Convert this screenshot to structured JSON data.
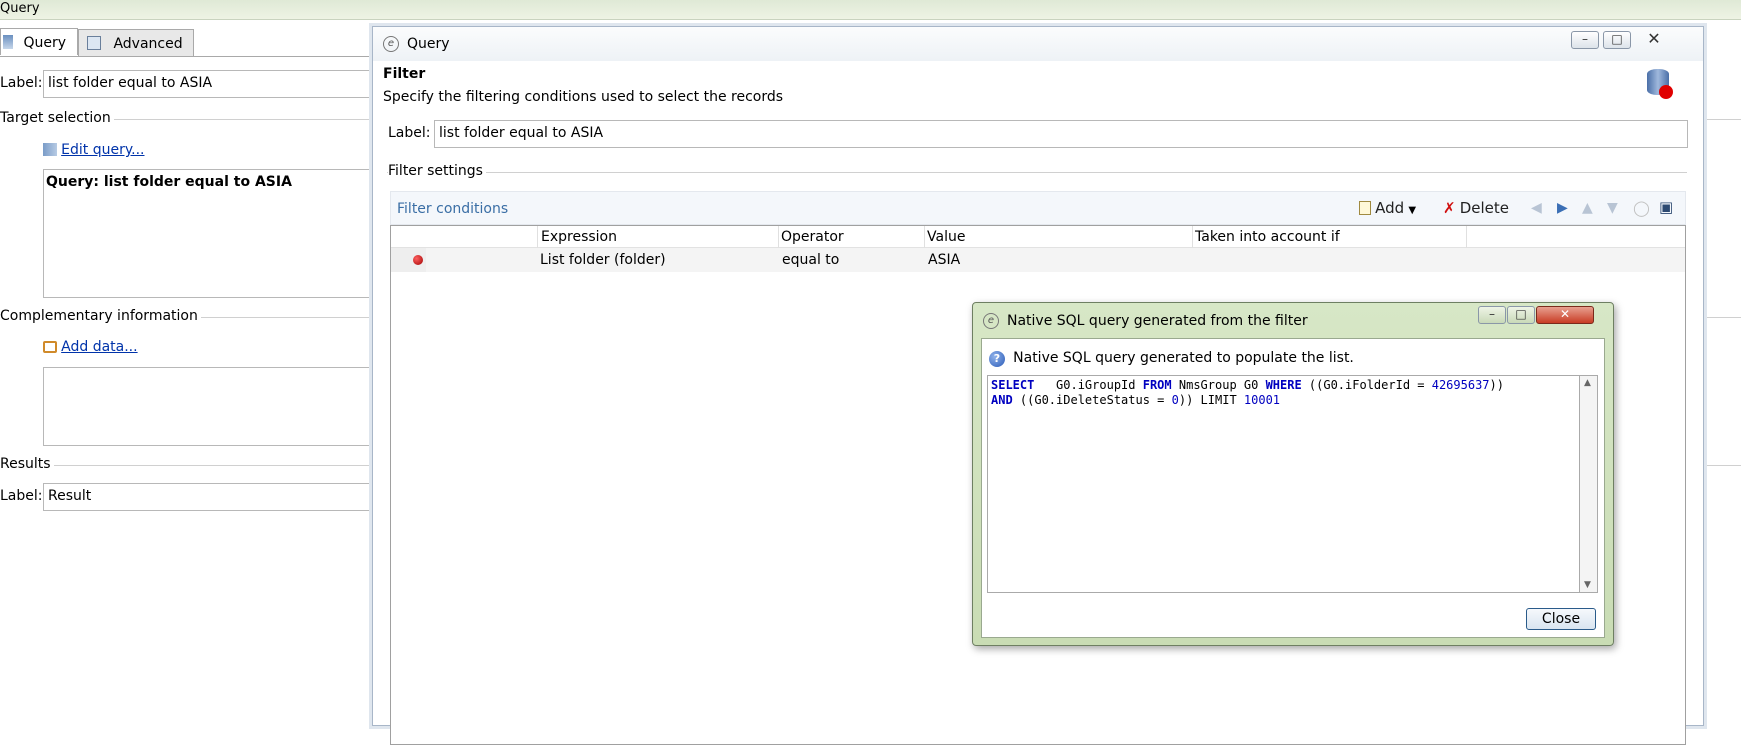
{
  "background": {
    "window_title": "Query",
    "tabs": [
      {
        "label": "Query"
      },
      {
        "label": "Advanced"
      }
    ],
    "label_field": {
      "label": "Label:",
      "value": "list folder equal to ASIA"
    },
    "target_selection": {
      "title": "Target selection",
      "edit_link": "Edit query...",
      "query_text": "Query: list folder equal to ASIA"
    },
    "complementary": {
      "title": "Complementary information",
      "add_link": "Add data..."
    },
    "results": {
      "title": "Results",
      "label": "Label:",
      "value": "Result"
    }
  },
  "query_dialog": {
    "title": "Query",
    "filter_title": "Filter",
    "filter_desc": "Specify the filtering conditions used to select the records",
    "label_field": {
      "label": "Label:",
      "value": "list folder equal to ASIA"
    },
    "filter_settings": "Filter settings",
    "filter_conditions": "Filter conditions",
    "toolbar": {
      "add": "Add",
      "delete": "Delete"
    },
    "columns": [
      "Expression",
      "Operator",
      "Value",
      "Taken into account if"
    ],
    "rows": [
      {
        "expression": "List folder (folder)",
        "operator": "equal to",
        "value": "ASIA",
        "taken": ""
      }
    ]
  },
  "sql_dialog": {
    "title": "Native SQL query generated from the filter",
    "info": "Native SQL query generated to populate the list.",
    "close_label": "Close"
  },
  "colors": {
    "link": "#0033aa",
    "sql_keyword": "#0000c0",
    "filter_conditions": "#3a6ea5",
    "red_dot": "#cc0000"
  }
}
